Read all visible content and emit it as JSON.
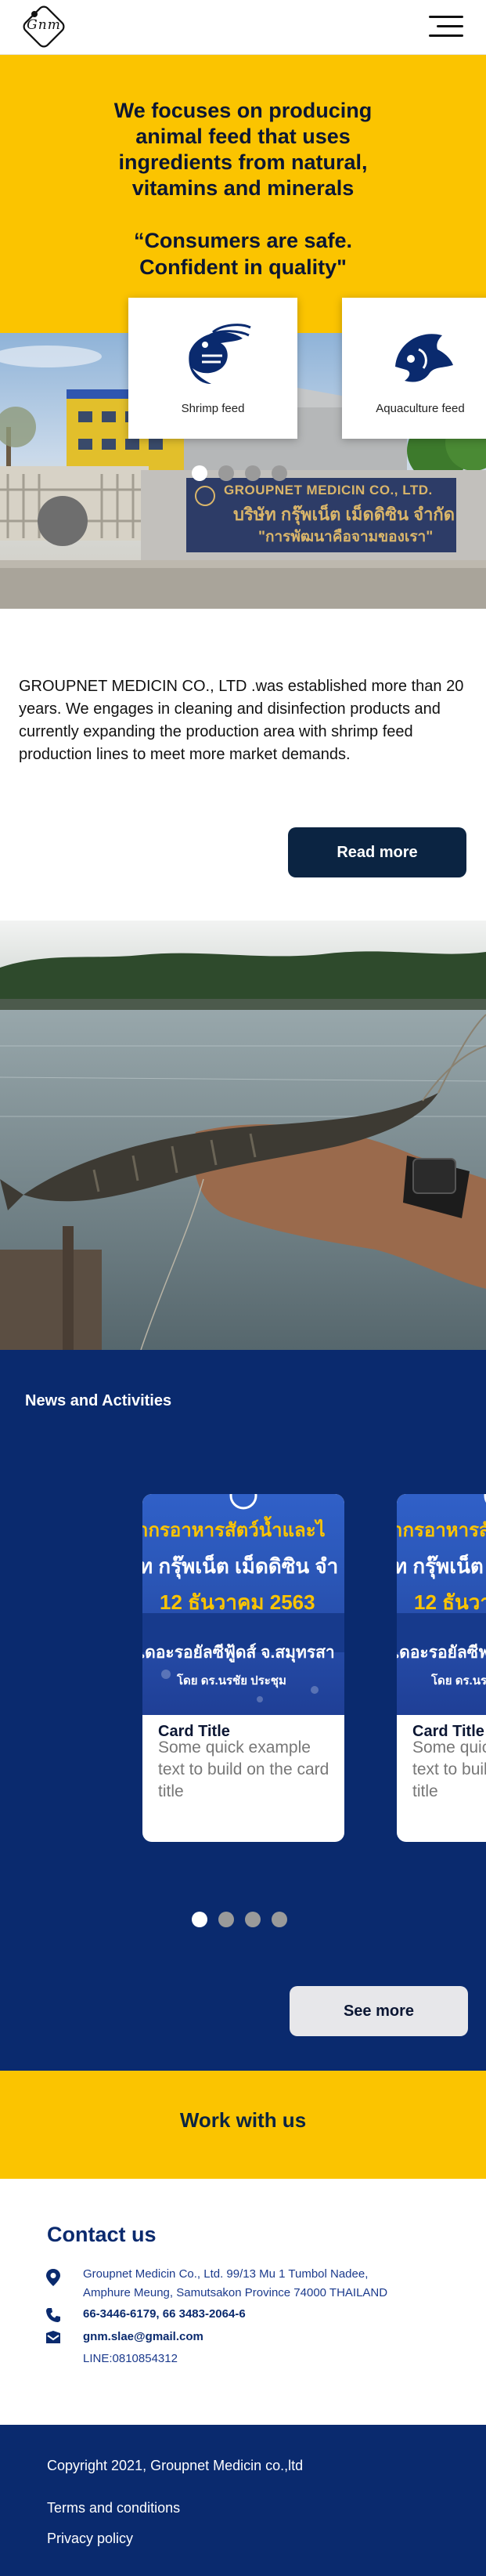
{
  "header": {
    "logo_text": "Gnm",
    "menu_icon": "hamburger-menu-icon"
  },
  "hero": {
    "headline": "We focuses on producing animal feed that uses ingredients from natural, vitamins and minerals",
    "quote": "“Consumers are safe. Confident in quality\"",
    "sign_company_en": "GROUPNET MEDICIN CO., LTD.",
    "sign_company_th": "บริษัท กรุ๊พเน็ต เม็ดดิซิน จำกัด",
    "sign_slogan_th": "\"การพัฒนาคือจามของเรา\"",
    "cards": [
      {
        "label": "Shrimp feed",
        "icon": "shrimp-icon"
      },
      {
        "label": "Aquaculture feed",
        "icon": "fish-icon"
      }
    ],
    "slides_total": 4,
    "active_slide": 1
  },
  "about": {
    "text": "GROUPNET MEDICIN CO., LTD .was established more than 20 years. We engages in cleaning and disinfection products and currently expanding the production area with shrimp feed production lines to meet more market demands.",
    "read_more_label": "Read more"
  },
  "news": {
    "title": "News and Activities",
    "cards": [
      {
        "banner_line1": "ากรอาหารสัตว์น้ำและไ",
        "banner_line2": "ัท กรุ๊พเน็ต เม็ดดิซิน จำ",
        "banner_date": "12 ธันวาคม 2563",
        "banner_line3": "เดอะรอยัลซีฟู้ดส์ จ.สมุทรสา",
        "banner_line4": "โดย ดร.นรชัย ประชุม",
        "title": "Card Title",
        "text": "Some quick example text to build on the card title"
      },
      {
        "banner_line1": "ากรอาหารสัตว์น้ำและไ",
        "banner_line2": "ัท กรุ๊พเน็ต เม็ดดิ",
        "banner_date": "12 ธันวาค",
        "banner_line3": "เดอะรอยัลซีฟ",
        "banner_line4": "โดย ดร.นร",
        "title": "Card Title",
        "text": "Some quick example text to build on the card title"
      }
    ],
    "slides_total": 4,
    "active_slide": 1,
    "see_more_label": "See more"
  },
  "work": {
    "title": "Work with us"
  },
  "contact": {
    "title": "Contact us",
    "address_line1": "Groupnet Medicin Co., Ltd. 99/13 Mu 1 Tumbol Nadee,",
    "address_line2": "Amphure Meung, Samutsakon Province 74000 THAILAND",
    "phone": "66-3446-6179, 66 3483-2064-6",
    "email": "gnm.slae@gmail.com",
    "line": "LINE:0810854312",
    "icons": [
      "location-pin-icon",
      "phone-icon",
      "email-icon"
    ]
  },
  "footer": {
    "copyright": "Copyright 2021, Groupnet Medicin co.,ltd",
    "terms": "Terms and conditions",
    "privacy": "Privacy policy"
  },
  "colors": {
    "yellow": "#fbc400",
    "navy": "#0a2a6e",
    "dark_navy": "#0b2442",
    "button_grey": "#e7e7ea"
  }
}
